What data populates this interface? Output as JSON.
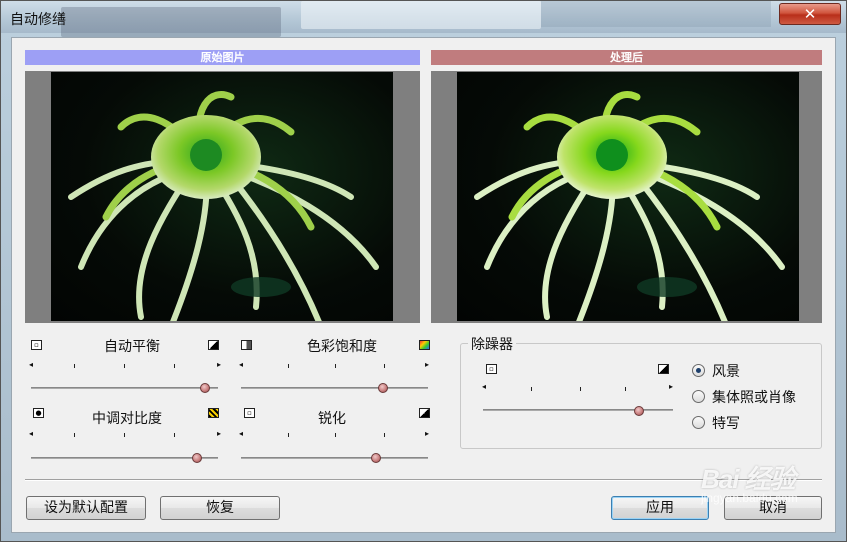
{
  "window": {
    "title": "自动修缮",
    "close_glyph": "✕"
  },
  "panels": {
    "original_label": "原始图片",
    "processed_label": "处理后"
  },
  "controls": {
    "auto_balance": {
      "label": "自动平衡",
      "level": 0.92
    },
    "saturation": {
      "label": "色彩饱和度",
      "level": 0.76
    },
    "midtone_contrast": {
      "label": "中调对比度",
      "level": 0.88
    },
    "sharpen": {
      "label": "锐化",
      "level": 0.72
    }
  },
  "denoiser": {
    "title": "除躁器",
    "level": 0.82,
    "options": [
      "风景",
      "集体照或肖像",
      "特写"
    ],
    "selected": "风景"
  },
  "buttons": {
    "set_default": "设为默认配置",
    "restore": "恢复",
    "apply": "应用",
    "cancel": "取消"
  },
  "watermark": {
    "main": "Bai 经验",
    "sub": "jingyan.baidu.com"
  }
}
